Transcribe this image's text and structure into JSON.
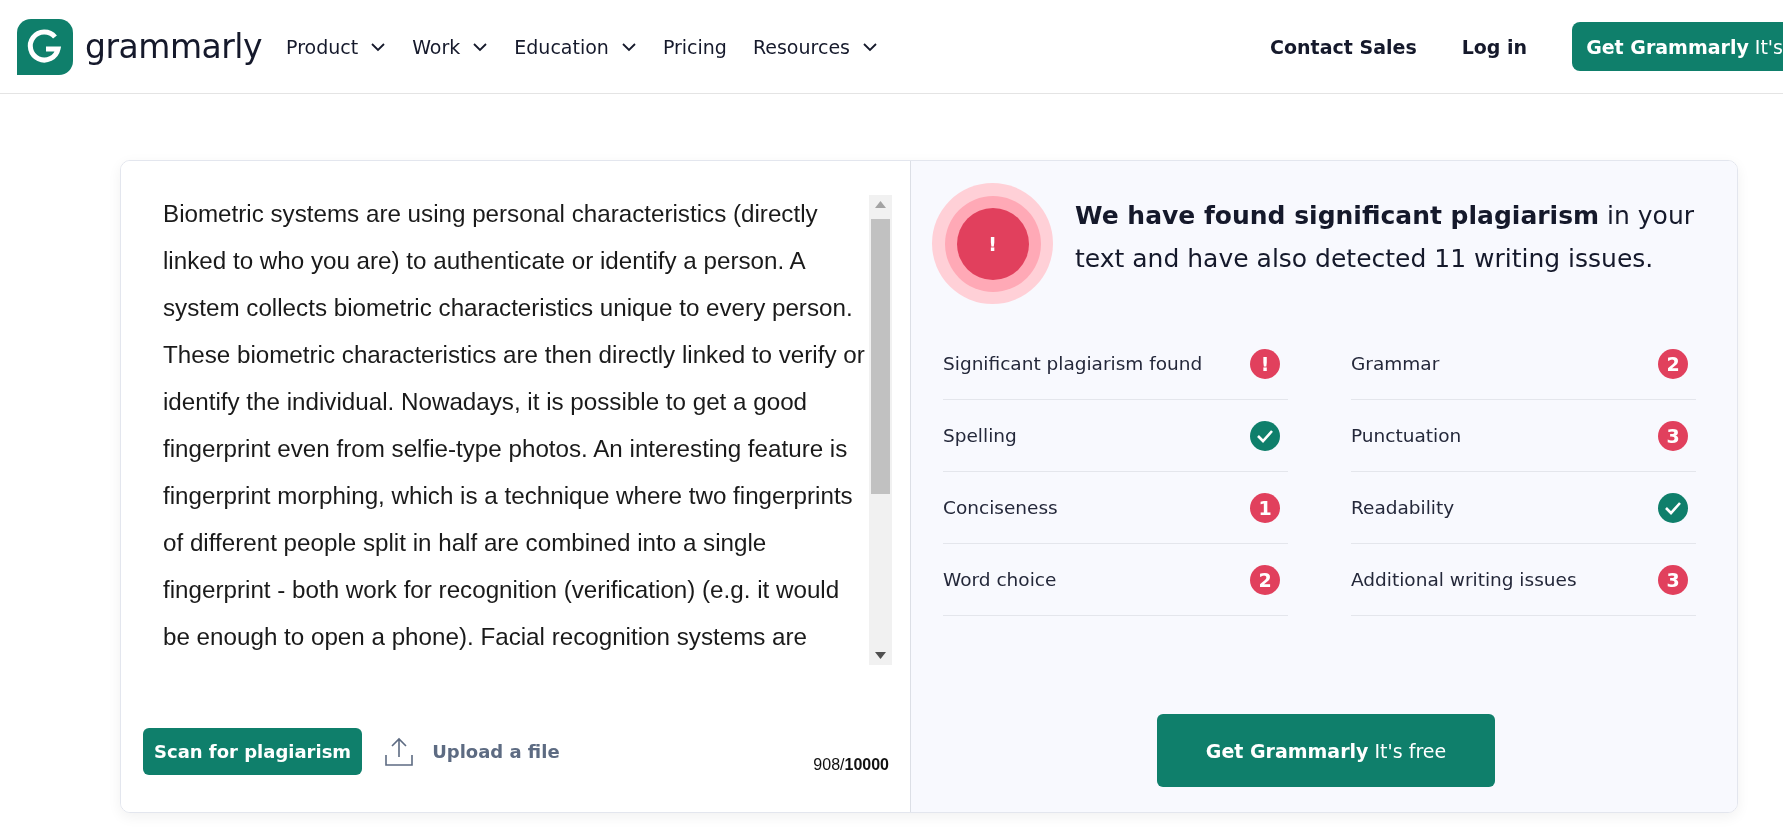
{
  "header": {
    "brand": "grammarly",
    "nav": [
      {
        "label": "Product",
        "dropdown": true
      },
      {
        "label": "Work",
        "dropdown": true
      },
      {
        "label": "Education",
        "dropdown": true
      },
      {
        "label": "Pricing",
        "dropdown": false
      },
      {
        "label": "Resources",
        "dropdown": true
      }
    ],
    "actions": [
      {
        "label": "Contact Sales",
        "kind": "link"
      },
      {
        "label": "Log in",
        "kind": "link"
      },
      {
        "label": "**Get Grammarly** It's",
        "kind": "primary"
      }
    ]
  },
  "editor": {
    "text": "Biometric systems are using personal characteristics (directly linked to who you are) to authenticate or identify a person. A system collects biometric characteristics unique to every person. These biometric characteristics are then directly linked to verify or identify the individual. Nowadays, it is possible to get a good fingerprint even from selfie-type photos. An interesting feature is fingerprint morphing, which is a technique where two fingerprints of different people split in half are combined into a single fingerprint - both work for recognition (verification) (e.g. it would be enough to open a phone). Facial recognition systems are",
    "scan_button": "Scan for plagiarism",
    "upload_label": "Upload a file",
    "counter": "908/**10000**"
  },
  "results": {
    "alert_mark": "!",
    "headline": "**We have found significant plagiarism** in your text and have also detected 11 writing issues.",
    "issue_columns": [
      {
        "items": [
          {
            "label": "Significant plagiarism found",
            "kind": "alert",
            "badge": "!"
          },
          {
            "label": "Spelling",
            "kind": "ok"
          },
          {
            "label": "Conciseness",
            "kind": "count",
            "badge": "1"
          },
          {
            "label": "Word choice",
            "kind": "count",
            "badge": "2"
          }
        ]
      },
      {
        "items": [
          {
            "label": "Grammar",
            "kind": "count",
            "badge": "2"
          },
          {
            "label": "Punctuation",
            "kind": "count",
            "badge": "3"
          },
          {
            "label": "Readability",
            "kind": "ok"
          },
          {
            "label": "Additional writing issues",
            "kind": "count",
            "badge": "3"
          }
        ]
      }
    ],
    "cta_button": "**Get Grammarly** It's free"
  }
}
